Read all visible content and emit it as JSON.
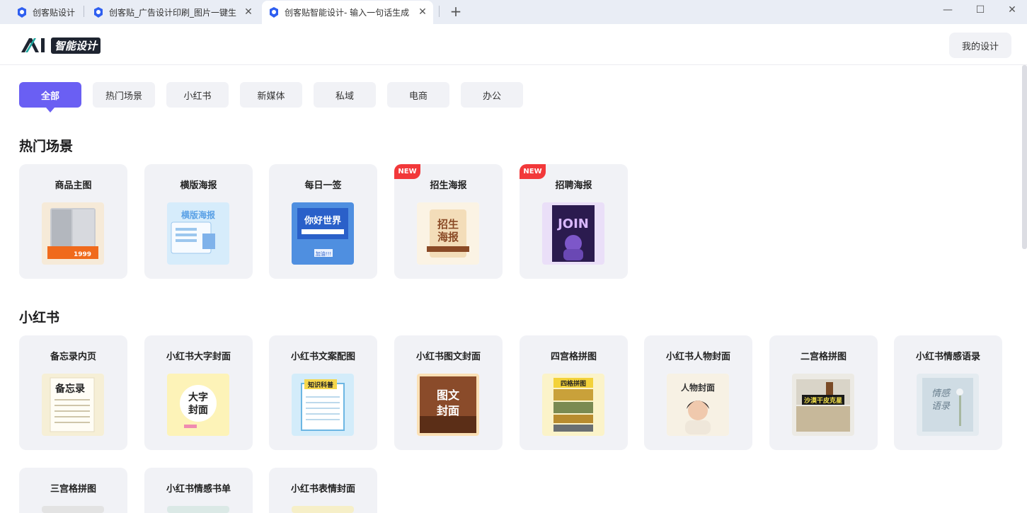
{
  "browser": {
    "tabs": [
      {
        "title": "创客贴设计",
        "closable": false,
        "active": false
      },
      {
        "title": "创客贴_广告设计印刷_图片一键生",
        "closable": true,
        "active": false
      },
      {
        "title": "创客贴智能设计- 输入一句话生成",
        "closable": true,
        "active": true
      }
    ],
    "new_tab_icon": "plus-icon",
    "window_controls": [
      "minimize-icon",
      "maximize-icon",
      "close-icon"
    ]
  },
  "header": {
    "logo_ai": "AI",
    "logo_text": "智能设计",
    "my_design_label": "我的设计"
  },
  "filters": [
    {
      "label": "全部",
      "active": true
    },
    {
      "label": "热门场景",
      "active": false
    },
    {
      "label": "小红书",
      "active": false
    },
    {
      "label": "新媒体",
      "active": false
    },
    {
      "label": "私域",
      "active": false
    },
    {
      "label": "电商",
      "active": false
    },
    {
      "label": "办公",
      "active": false
    }
  ],
  "sections": [
    {
      "title": "热门场景",
      "cards": [
        {
          "title": "商品主图",
          "badge": "",
          "thumb_text": [
            "1999"
          ]
        },
        {
          "title": "横版海报",
          "badge": "",
          "thumb_text": [
            "横版海报"
          ]
        },
        {
          "title": "每日一签",
          "badge": "",
          "thumb_text": [
            "你好世界",
            "加油!!!"
          ]
        },
        {
          "title": "招生海报",
          "badge": "NEW",
          "thumb_text": [
            "招生",
            "海报"
          ]
        },
        {
          "title": "招聘海报",
          "badge": "NEW",
          "thumb_text": [
            "JOIN"
          ]
        }
      ]
    },
    {
      "title": "小红书",
      "cards": [
        {
          "title": "备忘录内页",
          "thumb_text": [
            "备忘录"
          ]
        },
        {
          "title": "小红书大字封面",
          "thumb_text": [
            "大字",
            "封面"
          ]
        },
        {
          "title": "小红书文案配图",
          "thumb_text": [
            "知识科普"
          ]
        },
        {
          "title": "小红书图文封面",
          "thumb_text": [
            "图文",
            "封面"
          ]
        },
        {
          "title": "四宫格拼图",
          "thumb_text": [
            "四格拼图"
          ]
        },
        {
          "title": "小红书人物封面",
          "thumb_text": [
            "人物封面"
          ]
        },
        {
          "title": "二宫格拼图",
          "thumb_text": [
            "沙漠干皮克星"
          ]
        },
        {
          "title": "小红书情感语录",
          "thumb_text": [
            "情感",
            "语录"
          ]
        },
        {
          "title": "三宫格拼图",
          "thumb_text": []
        },
        {
          "title": "小红书情感书单",
          "thumb_text": []
        },
        {
          "title": "小红书表情封面",
          "thumb_text": []
        }
      ]
    }
  ],
  "colors": {
    "accent": "#6a5ff3",
    "card_bg": "#f1f2f6",
    "new_badge": "#f2383a"
  }
}
